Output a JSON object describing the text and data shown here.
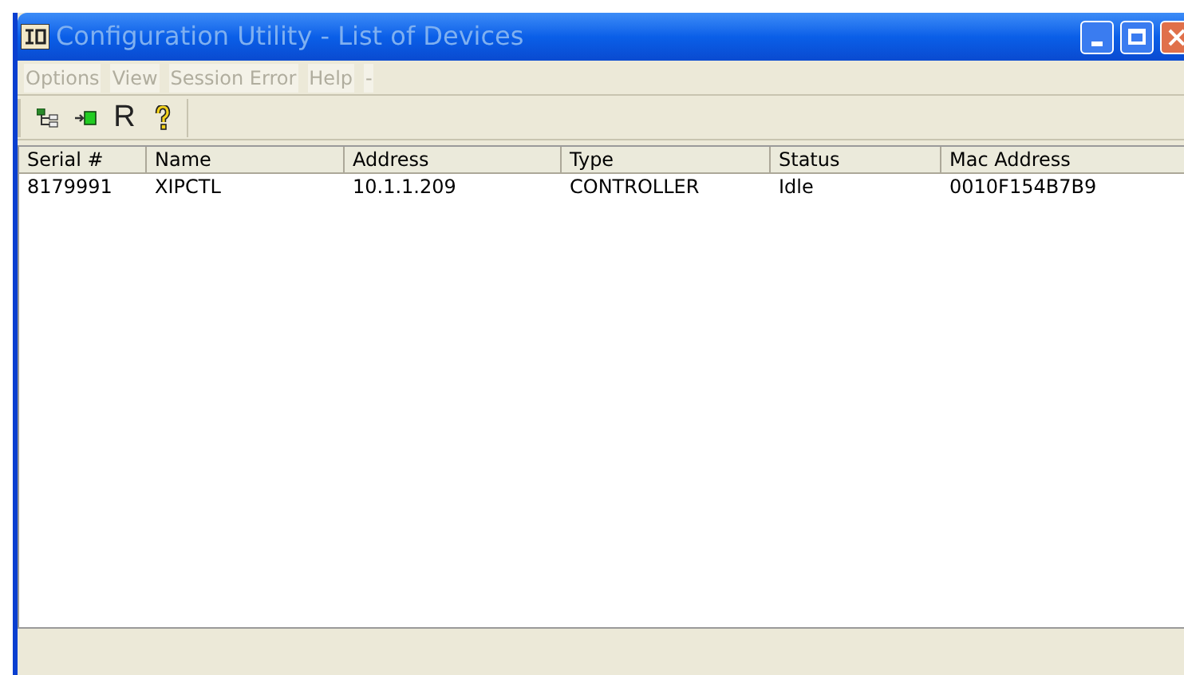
{
  "window": {
    "title": "Configuration Utility - List of Devices"
  },
  "menu": [
    {
      "label": "Options",
      "disabled": true
    },
    {
      "label": "View",
      "disabled": true
    },
    {
      "label": "Session Error",
      "disabled": true
    },
    {
      "label": "Help",
      "disabled": true
    },
    {
      "label": "-",
      "disabled": true
    }
  ],
  "toolbar": [
    {
      "kind": "tree"
    },
    {
      "kind": "connect"
    },
    {
      "kind": "text",
      "label": "R"
    },
    {
      "kind": "help"
    }
  ],
  "table": {
    "columns": [
      "Serial #",
      "Name",
      "Address",
      "Type",
      "Status",
      "Mac Address"
    ],
    "rows": [
      [
        "8179991",
        "XIPCTL",
        "10.1.1.209",
        "CONTROLLER",
        "Idle",
        "0010F154B7B9"
      ]
    ]
  }
}
